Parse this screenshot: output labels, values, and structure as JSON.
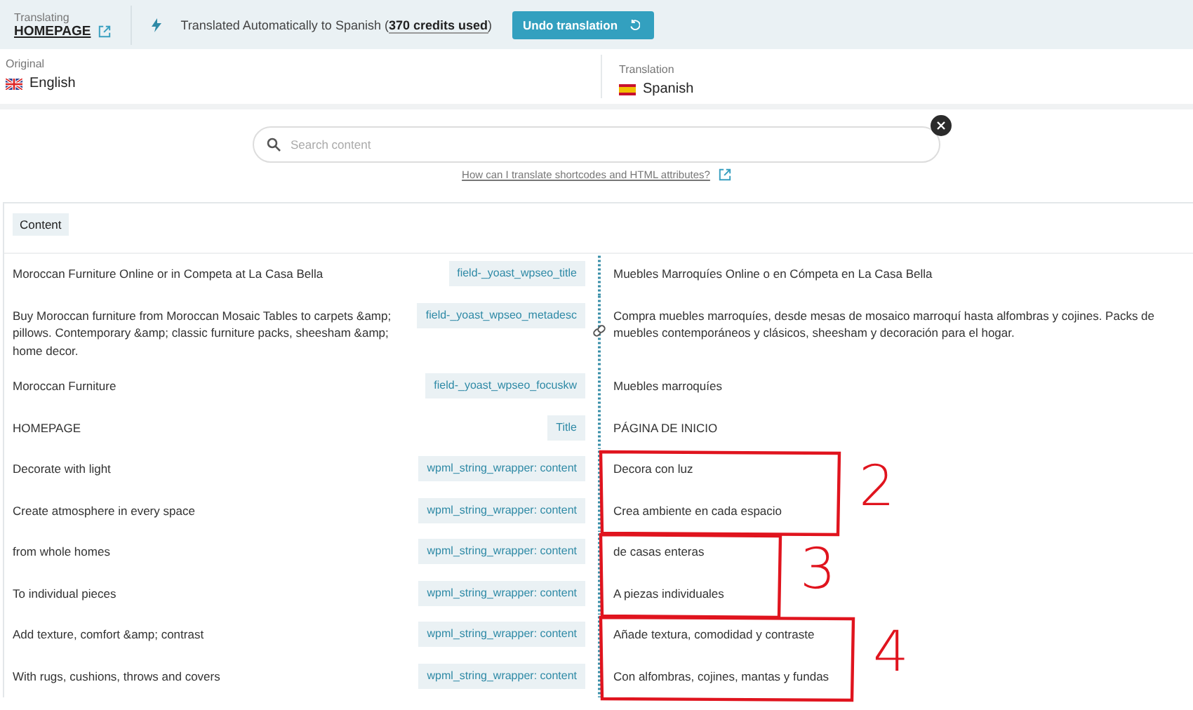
{
  "header": {
    "label": "Translating",
    "page": "HOMEPAGE",
    "status": "Translated Automatically to Spanish (",
    "credits": "370 credits used",
    "status_end": ")",
    "undo_button": "Undo translation"
  },
  "languages": [
    {
      "label": "Original",
      "name": "English"
    },
    {
      "label": "Translation",
      "name": "Spanish"
    }
  ],
  "search": {
    "placeholder": "Search content",
    "help_link": "How can I translate shortcodes and HTML attributes?"
  },
  "section_tag": "Content",
  "rows": [
    {
      "original": "Moroccan Furniture Online or in Competa at La Casa Bella",
      "field": "field-_yoast_wpseo_title",
      "translation": "Muebles Marroquíes Online o en Cómpeta en La Casa Bella",
      "linked": false
    },
    {
      "original": "Buy Moroccan furniture from Moroccan Mosaic Tables to carpets &amp; pillows. Contemporary &amp; classic furniture packs, sheesham &amp; home decor.",
      "field": "field-_yoast_wpseo_metadesc",
      "translation": "Compra muebles marroquíes, desde mesas de mosaico marroquí hasta alfombras y cojines. Packs de muebles contemporáneos y clásicos, sheesham y decoración para el hogar.",
      "linked": true
    },
    {
      "original": "Moroccan Furniture",
      "field": "field-_yoast_wpseo_focuskw",
      "translation": "Muebles marroquíes",
      "linked": false
    },
    {
      "original": "HOMEPAGE",
      "field": "Title",
      "translation": "PÁGINA DE INICIO",
      "linked": false
    },
    {
      "original": "Decorate with light",
      "field": "wpml_string_wrapper: content",
      "translation": "Decora con luz",
      "linked": false
    },
    {
      "original": "Create atmosphere in every space",
      "field": "wpml_string_wrapper: content",
      "translation": "Crea ambiente en cada espacio",
      "linked": false
    },
    {
      "original": "from whole homes",
      "field": "wpml_string_wrapper: content",
      "translation": "de casas enteras",
      "linked": false
    },
    {
      "original": "To individual pieces",
      "field": "wpml_string_wrapper: content",
      "translation": "A piezas individuales",
      "linked": false
    },
    {
      "original": "Add texture, comfort &amp; contrast",
      "field": "wpml_string_wrapper: content",
      "translation": "Añade textura, comodidad y contraste",
      "linked": false
    },
    {
      "original": "With rugs, cushions, throws and covers",
      "field": "wpml_string_wrapper: content",
      "translation": "Con alfombras, cojines, mantas y fundas",
      "linked": false
    }
  ],
  "annotations": [
    {
      "number": "2"
    },
    {
      "number": "3"
    },
    {
      "number": "4"
    }
  ]
}
